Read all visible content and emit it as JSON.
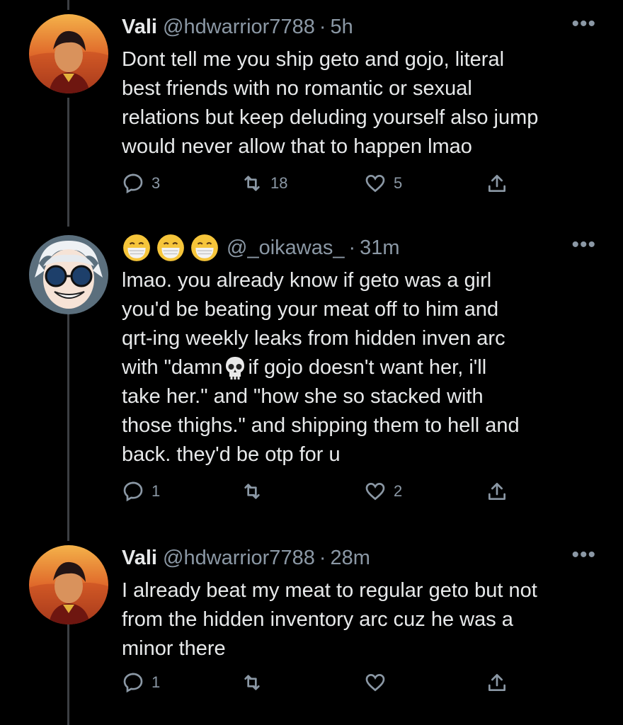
{
  "tweets": [
    {
      "name": "Vali",
      "handle": "@hdwarrior7788",
      "time": "5h",
      "text": "Dont tell me you ship geto and gojo, literal\nbest friends with no romantic or sexual\nrelations but keep deluding yourself also jump\nwould never allow that to happen lmao",
      "reply_count": "3",
      "retweet_count": "18",
      "like_count": "5",
      "more": "•••"
    },
    {
      "name": "",
      "emoji_count": 3,
      "handle": "@_oikawas_",
      "time": "31m",
      "text_lines": [
        "lmao. you already know if geto was a girl",
        "you'd be beating your meat off to him and",
        "qrt-ing weekly leaks from hidden inven arc",
        "with \"damn",
        "if gojo doesn't want her, i'll",
        "take her.\" and \"how she so stacked with",
        "those thighs.\" and shipping them to hell and",
        "back. they'd be otp for u"
      ],
      "reply_count": "1",
      "retweet_count": "",
      "like_count": "2",
      "more": "•••"
    },
    {
      "name": "Vali",
      "handle": "@hdwarrior7788",
      "time": "28m",
      "text": "I already beat my meat to regular geto but not\nfrom the hidden inventory arc cuz he was a\nminor there",
      "reply_count": "1",
      "retweet_count": "",
      "like_count": "",
      "more": "•••"
    }
  ],
  "colors": {
    "background": "#000000",
    "text": "#e7e9ea",
    "muted": "#8b98a5",
    "thread_line": "#3c3f43"
  },
  "icons": [
    "reply-icon",
    "retweet-icon",
    "like-icon",
    "share-icon",
    "more-icon",
    "skull-emoji",
    "mask-face-emoji"
  ]
}
